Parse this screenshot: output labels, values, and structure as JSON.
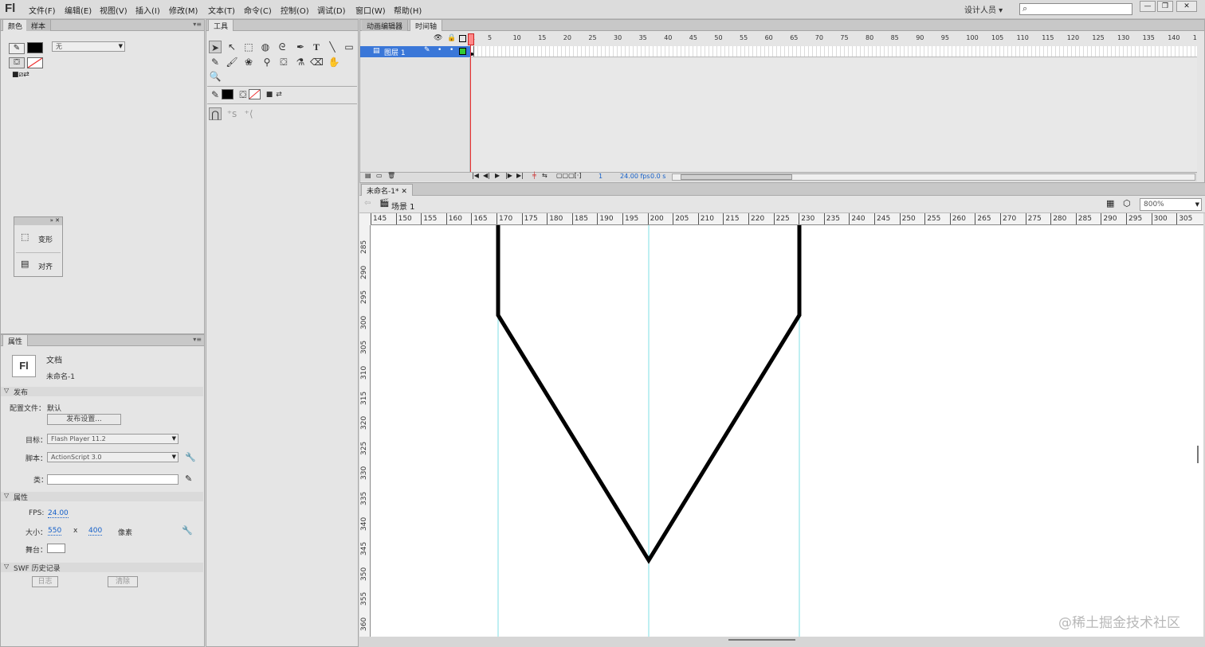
{
  "app": {
    "logo": "Fl"
  },
  "menu": [
    "文件(F)",
    "编辑(E)",
    "视图(V)",
    "插入(I)",
    "修改(M)",
    "文本(T)",
    "命令(C)",
    "控制(O)",
    "调试(D)",
    "窗口(W)",
    "帮助(H)"
  ],
  "workspace_label": "设计人员",
  "search_icon": "⌕",
  "color_panel": {
    "tabs": [
      "颜色",
      "样本"
    ],
    "fill_type": "无",
    "colors": {
      "stroke": "#000000",
      "fill": "none"
    }
  },
  "float_panel": {
    "items": [
      "变形",
      "对齐"
    ]
  },
  "tools_panel": {
    "title": "工具"
  },
  "properties": {
    "tab": "属性",
    "doc_type": "文档",
    "doc_name": "未命名-1",
    "sections": {
      "publish": "发布",
      "props": "属性",
      "swf": "SWF 历史记录"
    },
    "profile_label": "配置文件：",
    "profile_value": "默认",
    "publish_settings_btn": "发布设置...",
    "target_label": "目标：",
    "target_value": "Flash Player 11.2",
    "script_label": "脚本：",
    "script_value": "ActionScript 3.0",
    "class_label": "类：",
    "fps_label": "FPS:",
    "fps_value": "24.00",
    "size_label": "大小：",
    "width": "550",
    "x_sep": "x",
    "height": "400",
    "unit": "像素",
    "stage_label": "舞台：",
    "log_btn": "日志",
    "clear_btn": "清除"
  },
  "timeline": {
    "tabs": [
      "动画编辑器",
      "时间轴"
    ],
    "frame_numbers": [
      "1",
      "5",
      "10",
      "15",
      "20",
      "25",
      "30",
      "35",
      "40",
      "45",
      "50",
      "55",
      "60",
      "65",
      "70",
      "75",
      "80",
      "85",
      "90",
      "95",
      "100",
      "105",
      "110",
      "115",
      "120",
      "125",
      "130",
      "135",
      "140",
      "1"
    ],
    "layer_name": "图层 1",
    "status": {
      "frame": "1",
      "fps": "24.00 fps",
      "time": "0.0 s"
    }
  },
  "document": {
    "tab": "未命名-1*",
    "scene": "场景 1",
    "zoom": "800%"
  },
  "rulers": {
    "h": [
      "145",
      "150",
      "155",
      "160",
      "165",
      "170",
      "175",
      "180",
      "185",
      "190",
      "195",
      "200",
      "205",
      "210",
      "215",
      "220",
      "225",
      "230",
      "235",
      "240",
      "245",
      "250",
      "255",
      "260",
      "265",
      "270",
      "275",
      "280",
      "285",
      "290",
      "295",
      "300",
      "305"
    ],
    "v": [
      "285",
      "290",
      "295",
      "300",
      "305",
      "310",
      "315",
      "320",
      "325",
      "330",
      "335",
      "340",
      "345",
      "350",
      "355",
      "360"
    ]
  },
  "watermark": "@稀土掘金技术社区"
}
